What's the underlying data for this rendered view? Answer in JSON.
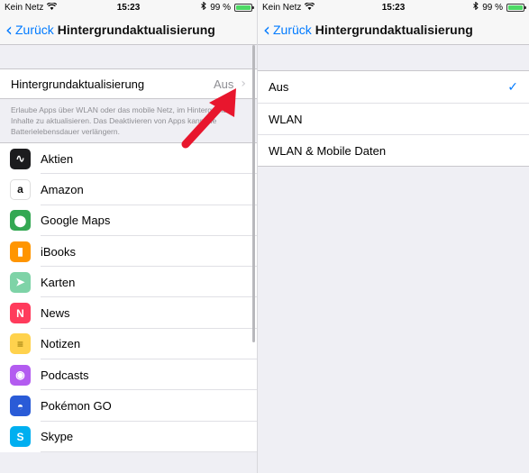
{
  "status": {
    "carrier": "Kein Netz",
    "time": "15:23",
    "battery": "99 %",
    "wifi_icon": "wifi-icon",
    "bluetooth_icon": "bluetooth-icon",
    "battery_fill": 0.99
  },
  "left": {
    "nav": {
      "back_label": "Zurück",
      "title": "Hintergrundaktualisierung"
    },
    "setting": {
      "label": "Hintergrundaktualisierung",
      "value": "Aus"
    },
    "footnote": "Erlaube Apps über WLAN oder das mobile Netz, im Hintergrund Inhalte zu aktualisieren. Das Deaktivieren von Apps kann die Batterielebensdauer verlängern.",
    "apps": [
      {
        "name": "Aktien",
        "icon": "stocks-icon",
        "color": "#1c1c1e"
      },
      {
        "name": "Amazon",
        "icon": "amazon-icon",
        "color": "#ffffff"
      },
      {
        "name": "Google Maps",
        "icon": "google-maps-icon",
        "color": "#34a853"
      },
      {
        "name": "iBooks",
        "icon": "ibooks-icon",
        "color": "#ff9500"
      },
      {
        "name": "Karten",
        "icon": "maps-icon",
        "color": "#7ed3a7"
      },
      {
        "name": "News",
        "icon": "news-icon",
        "color": "#ff3b5c"
      },
      {
        "name": "Notizen",
        "icon": "notes-icon",
        "color": "#ffd24d"
      },
      {
        "name": "Podcasts",
        "icon": "podcasts-icon",
        "color": "#b35cf0"
      },
      {
        "name": "Pokémon GO",
        "icon": "pokemon-go-icon",
        "color": "#2a5bd7"
      },
      {
        "name": "Skype",
        "icon": "skype-icon",
        "color": "#00aff0"
      }
    ]
  },
  "right": {
    "nav": {
      "back_label": "Zurück",
      "title": "Hintergrundaktualisierung"
    },
    "options": [
      {
        "label": "Aus",
        "selected": true
      },
      {
        "label": "WLAN",
        "selected": false
      },
      {
        "label": "WLAN & Mobile Daten",
        "selected": false
      }
    ]
  },
  "colors": {
    "accent": "#007aff",
    "arrow": "#e8162d"
  }
}
